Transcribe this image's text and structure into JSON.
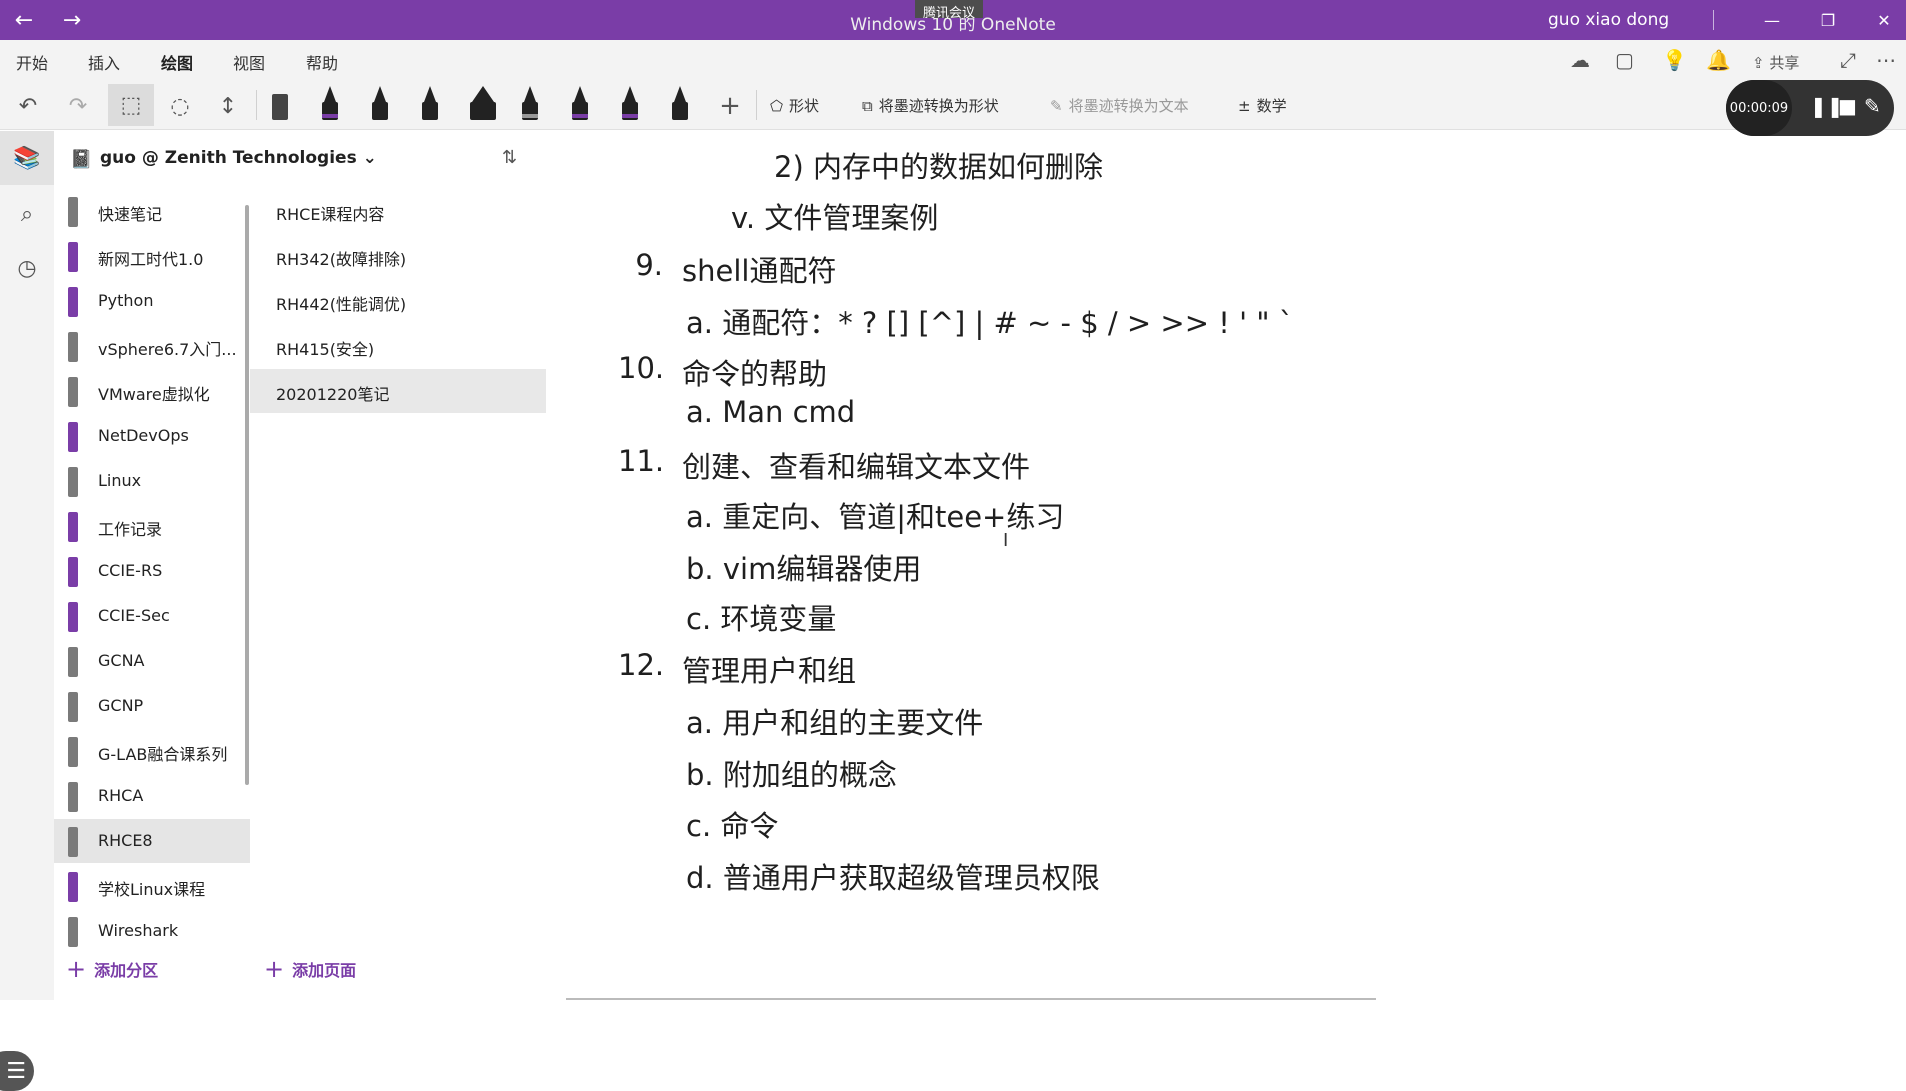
{
  "titlebar": {
    "title": "Windows 10 的 OneNote",
    "badge": "腾讯会议",
    "user": "guo xiao dong"
  },
  "menu": {
    "tabs": [
      "开始",
      "插入",
      "绘图",
      "视图",
      "帮助"
    ],
    "active_tab": "绘图",
    "share_label": "共享"
  },
  "ribbon": {
    "shapes_label": "形状",
    "ink_to_shape": "将墨迹转换为形状",
    "ink_to_text": "将墨迹转换为文本",
    "math_label": "数学",
    "pen_colors": [
      "#222222",
      "#7a3da7",
      "#222222",
      "#222222",
      "#555555",
      "#222222",
      "#7a3da7",
      "#7a3da7",
      "#222222"
    ]
  },
  "recording": {
    "time": "00:00:09"
  },
  "notebook": {
    "name": "guo @ Zenith Technologies"
  },
  "sections": [
    {
      "label": "快速笔记",
      "color": "#7a7a7a"
    },
    {
      "label": "新网工时代1.0",
      "color": "#7a3da7"
    },
    {
      "label": "Python",
      "color": "#7a3da7"
    },
    {
      "label": "vSphere6.7入门...",
      "color": "#7a7a7a"
    },
    {
      "label": "VMware虚拟化",
      "color": "#7a7a7a"
    },
    {
      "label": "NetDevOps",
      "color": "#7a3da7"
    },
    {
      "label": "Linux",
      "color": "#7a7a7a"
    },
    {
      "label": "工作记录",
      "color": "#7a3da7"
    },
    {
      "label": "CCIE-RS",
      "color": "#7a3da7"
    },
    {
      "label": "CCIE-Sec",
      "color": "#7a3da7"
    },
    {
      "label": "GCNA",
      "color": "#7a7a7a"
    },
    {
      "label": "GCNP",
      "color": "#7a7a7a"
    },
    {
      "label": "G-LAB融合课系列",
      "color": "#7a7a7a"
    },
    {
      "label": "RHCA",
      "color": "#7a7a7a"
    },
    {
      "label": "RHCE8",
      "color": "#7a7a7a"
    },
    {
      "label": "学校Linux课程",
      "color": "#7a3da7"
    },
    {
      "label": "Wireshark",
      "color": "#7a7a7a"
    }
  ],
  "selected_section": "RHCE8",
  "pages": [
    {
      "label": "RHCE课程内容"
    },
    {
      "label": "RH342(故障排除)"
    },
    {
      "label": "RH442(性能调优)"
    },
    {
      "label": "RH415(安全)"
    },
    {
      "label": "20201220笔记"
    }
  ],
  "selected_page": "20201220笔记",
  "add_section": "添加分区",
  "add_page": "添加页面",
  "content": {
    "item_2": "2)  内存中的数据如何删除",
    "item_v": "v.  文件管理案例",
    "n9": "9.",
    "h9": "shell通配符",
    "h9a": "a.  通配符：* ? [] [^] | # ~ - $ / > >> ! ' \"  `",
    "n10": "10.",
    "h10": "命令的帮助",
    "h10a": "a.  Man cmd",
    "n11": "11.",
    "h11": "创建、查看和编辑文本文件",
    "h11a": "a.  重定向、管道|和tee+练习",
    "h11b": "b.  vim编辑器使用",
    "h11c": "c.  环境变量",
    "n12": "12.",
    "h12": "管理用户和组",
    "h12a": "a.  用户和组的主要文件",
    "h12b": "b.  附加组的概念",
    "h12c": "c.  命令",
    "h12d": "d.  普通用户获取超级管理员权限"
  }
}
